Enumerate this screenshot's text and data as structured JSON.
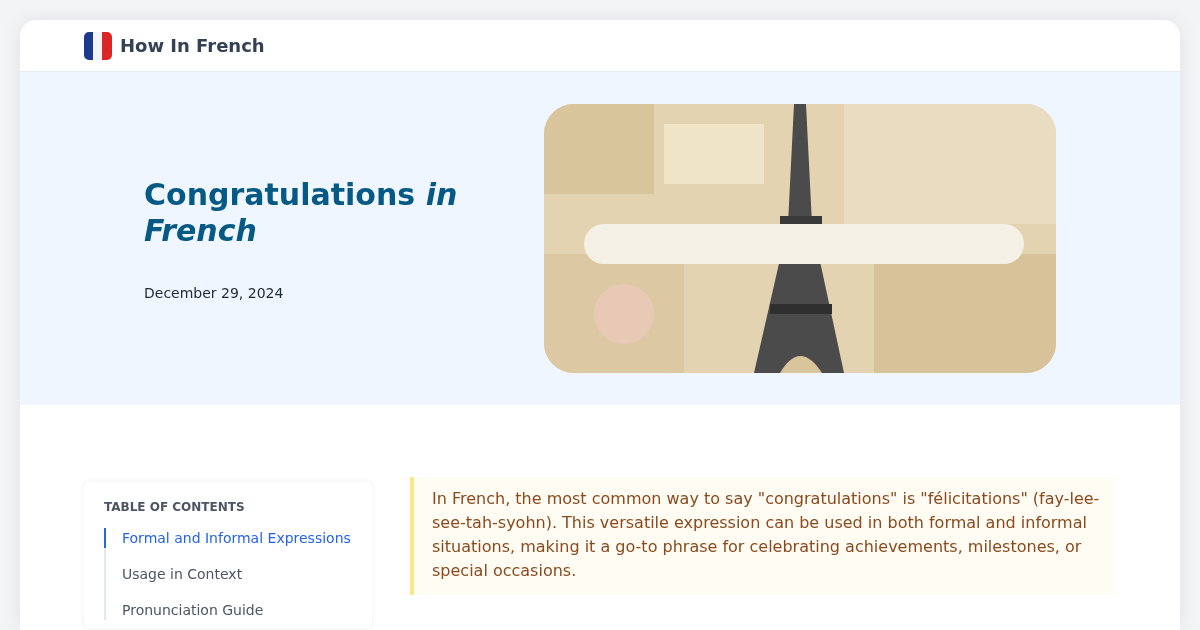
{
  "site": {
    "name": "How In French"
  },
  "hero": {
    "title": "Congratulations *in French*",
    "date": "December 29, 2024"
  },
  "toc": {
    "heading": "TABLE OF CONTENTS",
    "items": [
      {
        "label": "Formal and Informal Expressions",
        "selected": true
      },
      {
        "label": "Usage in Context",
        "selected": false
      },
      {
        "label": "Pronunciation Guide",
        "selected": false
      }
    ]
  },
  "intro": "In French, the most common way to say \"congratulations\" is \"félicitations\" (fay-lee-see-tah-syohn). This versatile expression can be used in both formal and informal situations, making it a go-to phrase for celebrating achievements, milestones, or special occasions."
}
